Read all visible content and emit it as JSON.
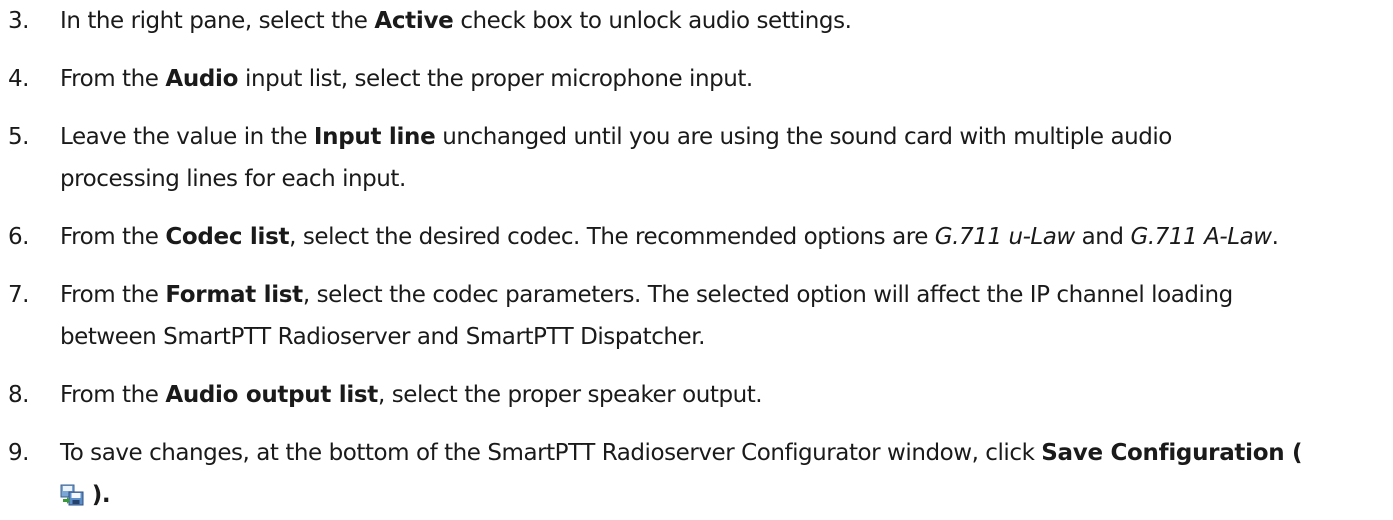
{
  "steps": [
    {
      "number": "3.",
      "lines": [
        [
          {
            "t": "In the right pane, select the ",
            "s": "n"
          },
          {
            "t": "Active",
            "s": "b"
          },
          {
            "t": " check box to unlock audio settings.",
            "s": "n"
          }
        ]
      ]
    },
    {
      "number": "4.",
      "lines": [
        [
          {
            "t": "From the ",
            "s": "n"
          },
          {
            "t": "Audio",
            "s": "b"
          },
          {
            "t": " input list, select the proper microphone input.",
            "s": "n"
          }
        ]
      ]
    },
    {
      "number": "5.",
      "lines": [
        [
          {
            "t": "Leave the value in the ",
            "s": "n"
          },
          {
            "t": "Input line",
            "s": "b"
          },
          {
            "t": " unchanged until you are using the sound card with multiple audio",
            "s": "n"
          }
        ],
        [
          {
            "t": "processing lines for each input.",
            "s": "n"
          }
        ]
      ]
    },
    {
      "number": "6.",
      "lines": [
        [
          {
            "t": "From the ",
            "s": "n"
          },
          {
            "t": "Codec list",
            "s": "b"
          },
          {
            "t": ", select the desired codec. The recommended options are ",
            "s": "n"
          },
          {
            "t": "G.711 u-Law",
            "s": "i"
          },
          {
            "t": " and ",
            "s": "n"
          },
          {
            "t": "G.711 A-Law",
            "s": "i"
          },
          {
            "t": ".",
            "s": "n"
          }
        ]
      ]
    },
    {
      "number": "7.",
      "lines": [
        [
          {
            "t": "From the ",
            "s": "n"
          },
          {
            "t": "Format list",
            "s": "b"
          },
          {
            "t": ", select the codec parameters. The selected option will affect the IP channel loading",
            "s": "n"
          }
        ],
        [
          {
            "t": "between SmartPTT Radioserver and SmartPTT Dispatcher.",
            "s": "n"
          }
        ]
      ]
    },
    {
      "number": "8.",
      "lines": [
        [
          {
            "t": "From the ",
            "s": "n"
          },
          {
            "t": "Audio output list",
            "s": "b"
          },
          {
            "t": ", select the proper speaker output.",
            "s": "n"
          }
        ]
      ]
    },
    {
      "number": "9.",
      "lines": [
        [
          {
            "t": "To save changes, at the bottom of the SmartPTT Radioserver Configurator window, click ",
            "s": "n"
          },
          {
            "t": "Save Configuration (",
            "s": "b"
          }
        ],
        [
          {
            "icon": "save-configuration-icon"
          },
          {
            "t": " ).",
            "s": "b"
          }
        ]
      ]
    }
  ]
}
